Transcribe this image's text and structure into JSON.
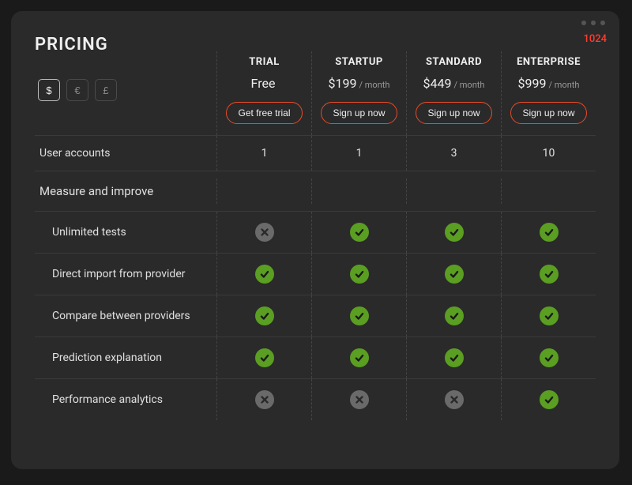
{
  "badge": "1024",
  "title": "PRICING",
  "currencies": [
    {
      "symbol": "$",
      "active": true
    },
    {
      "symbol": "€",
      "active": false
    },
    {
      "symbol": "£",
      "active": false
    }
  ],
  "plans": [
    {
      "name": "TRIAL",
      "price": "Free",
      "per": "",
      "cta": "Get free trial"
    },
    {
      "name": "STARTUP",
      "price": "$199",
      "per": "/ month",
      "cta": "Sign up now"
    },
    {
      "name": "STANDARD",
      "price": "$449",
      "per": "/ month",
      "cta": "Sign up now"
    },
    {
      "name": "ENTERPRISE",
      "price": "$999",
      "per": "/ month",
      "cta": "Sign up now"
    }
  ],
  "rows": [
    {
      "type": "value",
      "label": "User accounts",
      "cells": [
        "1",
        "1",
        "3",
        "10"
      ]
    },
    {
      "type": "section",
      "label": "Measure and improve"
    },
    {
      "type": "feature",
      "label": "Unlimited tests",
      "cells": [
        "cross",
        "check",
        "check",
        "check"
      ]
    },
    {
      "type": "feature",
      "label": "Direct import from provider",
      "cells": [
        "check",
        "check",
        "check",
        "check"
      ]
    },
    {
      "type": "feature",
      "label": "Compare between providers",
      "cells": [
        "check",
        "check",
        "check",
        "check"
      ]
    },
    {
      "type": "feature",
      "label": "Prediction explanation",
      "cells": [
        "check",
        "check",
        "check",
        "check"
      ]
    },
    {
      "type": "feature",
      "label": "Performance analytics",
      "cells": [
        "cross",
        "cross",
        "cross",
        "check"
      ]
    }
  ]
}
